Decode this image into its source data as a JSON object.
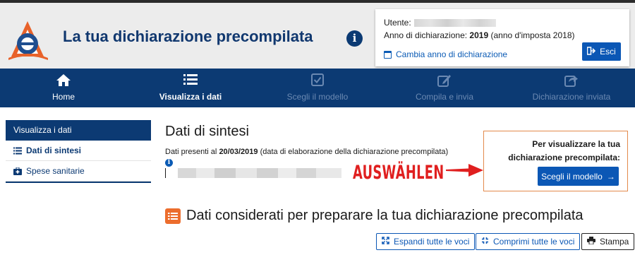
{
  "header": {
    "app_title": "La tua dichiarazione precompilata",
    "info_glyph": "i",
    "user_label": "Utente:",
    "year_prefix": "Anno di dichiarazione:",
    "year_value": "2019",
    "year_suffix": "(anno d'imposta 2018)",
    "change_year_label": "Cambia anno di dichiarazione",
    "exit_label": "Esci"
  },
  "nav": {
    "items": [
      {
        "label": "Home",
        "icon": "home-icon",
        "active": true
      },
      {
        "label": "Visualizza i dati",
        "icon": "list-icon",
        "active": true,
        "bold": true
      },
      {
        "label": "Scegli il modello",
        "icon": "checkbox-icon",
        "active": false
      },
      {
        "label": "Compila e invia",
        "icon": "edit-icon",
        "active": false
      },
      {
        "label": "Dichiarazione inviata",
        "icon": "share-icon",
        "active": false
      }
    ]
  },
  "sidebar": {
    "heading": "Visualizza i dati",
    "items": [
      {
        "label": "Dati di sintesi",
        "icon": "list-icon",
        "active": true
      },
      {
        "label": "Spese sanitarie",
        "icon": "medkit-icon",
        "active": false
      }
    ]
  },
  "main": {
    "title": "Dati di sintesi",
    "data_prefix": "Dati presenti al",
    "data_date": "20/03/2019",
    "data_suffix": "(data di elaborazione della dichiarazione precompilata)",
    "info_glyph": "i",
    "annotation": "AUSWÄHLEN",
    "cta_line1": "Per visualizzare la tua",
    "cta_line2": "dichiarazione precompilata:",
    "cta_button": "Scegli il modello",
    "cta_arrow": "→",
    "section_title": "Dati considerati per preparare la tua dichiarazione precompilata",
    "buttons": {
      "expand": "Espandi tutte le voci",
      "collapse": "Comprimi tutte le voci",
      "print": "Stampa"
    }
  },
  "colors": {
    "brand_dark": "#0c3a73",
    "button_blue": "#0b57b5",
    "accent_orange": "#ec6d2d",
    "annotation_red": "#e01f1f"
  }
}
